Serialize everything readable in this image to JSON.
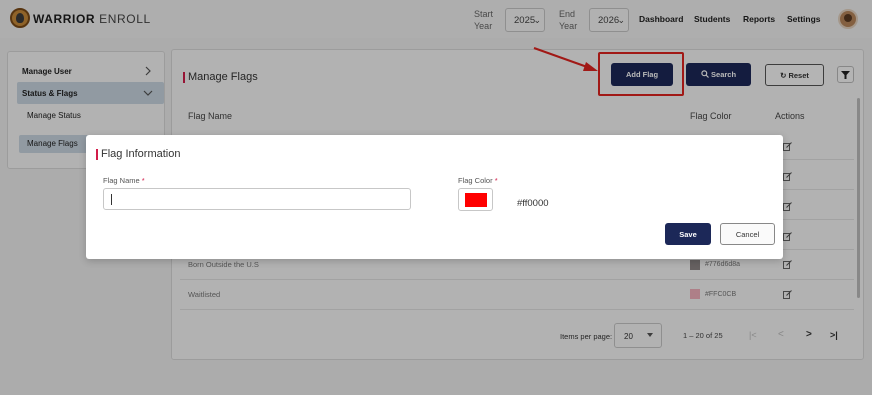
{
  "header": {
    "brand_bold": "WARRIOR",
    "brand_light": "ENROLL",
    "start_year": {
      "label_line1": "Start",
      "label_line2": "Year",
      "value": "2025"
    },
    "end_year": {
      "label_line1": "End",
      "label_line2": "Year",
      "value": "2026"
    },
    "nav": [
      "Dashboard",
      "Students",
      "Reports",
      "Settings"
    ]
  },
  "sidebar": {
    "items": [
      {
        "label": "Manage User"
      },
      {
        "label": "Status & Flags"
      },
      {
        "label": "Manage Status"
      },
      {
        "label": "Manage Flags"
      }
    ]
  },
  "main": {
    "title": "Manage Flags",
    "buttons": {
      "add_flag": "Add Flag",
      "search": "Search",
      "reset": "Reset"
    },
    "columns": {
      "name": "Flag Name",
      "color": "Flag Color",
      "actions": "Actions"
    },
    "rows": [
      {
        "name": "Born Outside the U.S",
        "hex": "#776d6d8a",
        "color": "#8e8787"
      },
      {
        "name": "Waitlisted",
        "hex": "#FFC0CB",
        "color": "#f2b1bd"
      }
    ],
    "pager": {
      "label": "Items per page:",
      "per_page": "20",
      "range": "1 – 20 of 25",
      "first": "|<",
      "prev": "<",
      "next": ">",
      "last": ">|"
    }
  },
  "modal": {
    "title": "Flag Information",
    "name_label": "Flag Name",
    "color_label": "Flag Color",
    "required_mark": "*",
    "color_value": "#ff0000",
    "save": "Save",
    "cancel": "Cancel"
  },
  "colors": {
    "navy": "#1c2858",
    "accent": "#d21d4a",
    "highlight": "#e0231f",
    "selected_color": "#ff0000"
  }
}
